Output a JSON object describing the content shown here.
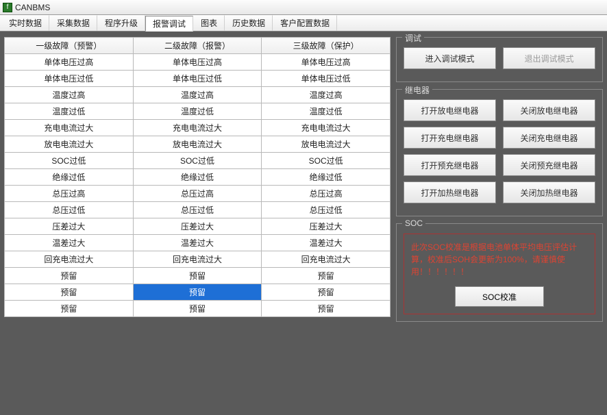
{
  "window": {
    "title": "CANBMS",
    "icon_label": "f"
  },
  "tabs": [
    {
      "label": "实时数据"
    },
    {
      "label": "采集数据"
    },
    {
      "label": "程序升级"
    },
    {
      "label": "报警调试"
    },
    {
      "label": "图表"
    },
    {
      "label": "历史数据"
    },
    {
      "label": "客户配置数据"
    }
  ],
  "active_tab_index": 3,
  "table": {
    "headers": [
      "一级故障（预警）",
      "二级故障（报警）",
      "三级故障（保护）"
    ],
    "rows": [
      [
        "单体电压过高",
        "单体电压过高",
        "单体电压过高"
      ],
      [
        "单体电压过低",
        "单体电压过低",
        "单体电压过低"
      ],
      [
        "温度过高",
        "温度过高",
        "温度过高"
      ],
      [
        "温度过低",
        "温度过低",
        "温度过低"
      ],
      [
        "充电电流过大",
        "充电电流过大",
        "充电电流过大"
      ],
      [
        "放电电流过大",
        "放电电流过大",
        "放电电流过大"
      ],
      [
        "SOC过低",
        "SOC过低",
        "SOC过低"
      ],
      [
        "绝缘过低",
        "绝缘过低",
        "绝缘过低"
      ],
      [
        "总压过高",
        "总压过高",
        "总压过高"
      ],
      [
        "总压过低",
        "总压过低",
        "总压过低"
      ],
      [
        "压差过大",
        "压差过大",
        "压差过大"
      ],
      [
        "温差过大",
        "温差过大",
        "温差过大"
      ],
      [
        "回充电流过大",
        "回充电流过大",
        "回充电流过大"
      ],
      [
        "预留",
        "预留",
        "预留"
      ],
      [
        "预留",
        "预留",
        "预留"
      ],
      [
        "预留",
        "预留",
        "预留"
      ]
    ],
    "selected": {
      "row": 14,
      "col": 1
    }
  },
  "debug_panel": {
    "title": "调试",
    "enter": "进入调试模式",
    "exit": "退出调试模式"
  },
  "relay_panel": {
    "title": "继电器",
    "buttons": [
      [
        "打开放电继电器",
        "关闭放电继电器"
      ],
      [
        "打开充电继电器",
        "关闭充电继电器"
      ],
      [
        "打开预充继电器",
        "关闭预充继电器"
      ],
      [
        "打开加热继电器",
        "关闭加热继电器"
      ]
    ]
  },
  "soc_panel": {
    "title": "SOC",
    "text": "此次SOC校准是根据电池单体平均电压评估计算，校准后SOH会更新为100%，请谨慎使用！！！！！！",
    "button": "SOC校准"
  }
}
